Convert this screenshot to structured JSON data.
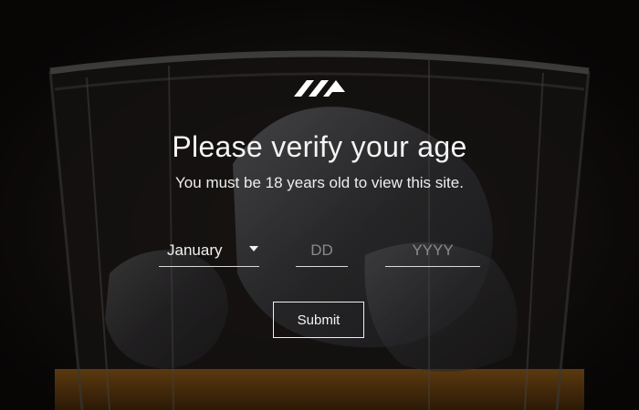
{
  "colors": {
    "background": "#0c0a09",
    "text": "#ffffff",
    "placeholder": "#8a8a8a",
    "whisky": "#6b4412"
  },
  "brand": {
    "logo_icon": "brand-logo-icon"
  },
  "gate": {
    "title": "Please verify your age",
    "subtitle": "You must be 18 years old to view this site.",
    "month": {
      "selected": "January"
    },
    "day": {
      "placeholder": "DD"
    },
    "year": {
      "placeholder": "YYYY"
    },
    "submit_label": "Submit"
  }
}
